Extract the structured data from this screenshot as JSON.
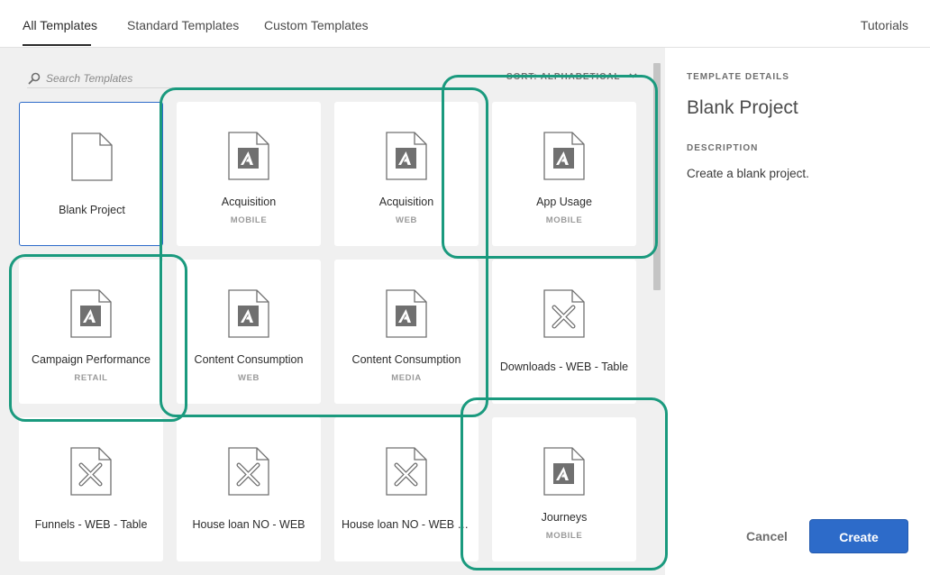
{
  "tabs": [
    {
      "label": "All Templates",
      "active": true
    },
    {
      "label": "Standard Templates",
      "active": false
    },
    {
      "label": "Custom Templates",
      "active": false
    }
  ],
  "tutorials_label": "Tutorials",
  "search": {
    "placeholder": "Search Templates",
    "value": ""
  },
  "sort_label": "SORT: ALPHABETICAL",
  "templates": [
    {
      "title": "Blank Project",
      "sub": "",
      "icon": "blank-doc-icon",
      "selected": true
    },
    {
      "title": "Acquisition",
      "sub": "MOBILE",
      "icon": "adobe-doc-icon"
    },
    {
      "title": "Acquisition",
      "sub": "WEB",
      "icon": "adobe-doc-icon"
    },
    {
      "title": "App Usage",
      "sub": "MOBILE",
      "icon": "adobe-doc-icon"
    },
    {
      "title": "Campaign Performance",
      "sub": "RETAIL",
      "icon": "adobe-doc-icon"
    },
    {
      "title": "Content Consumption",
      "sub": "WEB",
      "icon": "adobe-doc-icon"
    },
    {
      "title": "Content Consumption",
      "sub": "MEDIA",
      "icon": "adobe-doc-icon"
    },
    {
      "title": "Downloads - WEB - Table",
      "sub": "",
      "icon": "custom-doc-icon"
    },
    {
      "title": "Funnels - WEB - Table",
      "sub": "",
      "icon": "custom-doc-icon"
    },
    {
      "title": "House loan NO - WEB",
      "sub": "",
      "icon": "custom-doc-icon"
    },
    {
      "title": "House loan NO - WEB - ...",
      "sub": "",
      "icon": "custom-doc-icon"
    },
    {
      "title": "Journeys",
      "sub": "MOBILE",
      "icon": "adobe-doc-icon"
    }
  ],
  "details": {
    "section_label": "TEMPLATE DETAILS",
    "title": "Blank Project",
    "description_label": "DESCRIPTION",
    "description": "Create a blank project."
  },
  "buttons": {
    "cancel": "Cancel",
    "create": "Create"
  },
  "colors": {
    "accent": "#2d6bc9",
    "highlight": "#1a9a7e",
    "gallery_bg": "#f0f0f0"
  }
}
